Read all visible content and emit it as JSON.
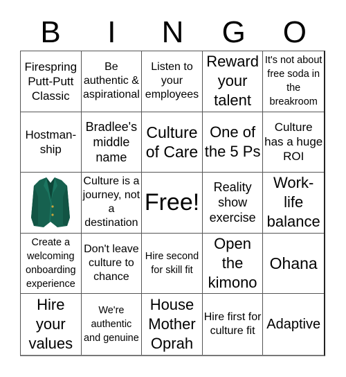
{
  "header": {
    "letters": [
      "B",
      "I",
      "N",
      "G",
      "O"
    ]
  },
  "card": {
    "cells": [
      {
        "text": "Firespring Putt-Putt Classic"
      },
      {
        "text": "Be authentic & aspirational"
      },
      {
        "text": "Listen to your employees"
      },
      {
        "text": "Reward your talent"
      },
      {
        "text": "It's not about free soda in the breakroom"
      },
      {
        "text": "Hostman-ship"
      },
      {
        "text": "Bradlee's middle name"
      },
      {
        "text": "Culture of Care"
      },
      {
        "text": "One of the 5 Ps"
      },
      {
        "text": "Culture has a huge ROI"
      },
      {
        "image": "green-jacket-icon"
      },
      {
        "text": "Culture is a journey, not a destination"
      },
      {
        "text": "Free!"
      },
      {
        "text": "Reality show exercise"
      },
      {
        "text": "Work-life balance"
      },
      {
        "text": "Create a welcoming onboarding experience"
      },
      {
        "text": "Don't leave culture to chance"
      },
      {
        "text": "Hire second for skill fit"
      },
      {
        "text": "Open the kimono"
      },
      {
        "text": "Ohana"
      },
      {
        "text": "Hire your values"
      },
      {
        "text": "We're authentic and genuine"
      },
      {
        "text": "House Mother Oprah"
      },
      {
        "text": "Hire first for culture fit"
      },
      {
        "text": "Adaptive"
      }
    ]
  },
  "colors": {
    "jacket": "#16614f",
    "jacket_dark": "#0d4638",
    "button": "#c9a43a"
  }
}
